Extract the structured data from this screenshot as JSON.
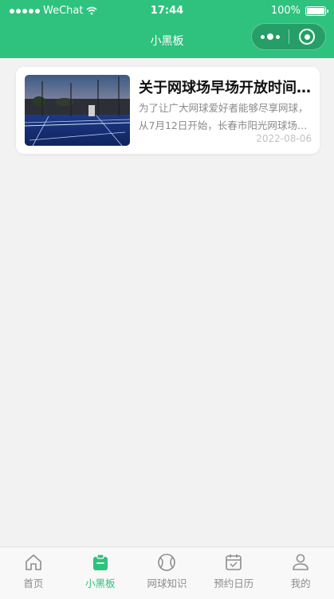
{
  "status_bar": {
    "carrier": "WeChat",
    "time": "17:44",
    "battery": "100%",
    "battery_level": 1.0
  },
  "nav": {
    "title": "小黑板"
  },
  "articles": [
    {
      "title": "关于网球场早场开放时间的通知",
      "summary": "为了让广大网球爱好者能够尽享网球，从7月12日开始，长春市阳光网球场早场开放",
      "date": "2022-08-06"
    }
  ],
  "tabbar": {
    "active_color": "#2ec27e",
    "items": [
      {
        "label": "首页",
        "icon": "home-icon",
        "active": false
      },
      {
        "label": "小黑板",
        "icon": "clipboard-icon",
        "active": true
      },
      {
        "label": "网球知识",
        "icon": "tennis-ball-icon",
        "active": false
      },
      {
        "label": "预约日历",
        "icon": "calendar-check-icon",
        "active": false
      },
      {
        "label": "我的",
        "icon": "user-icon",
        "active": false
      }
    ]
  },
  "colors": {
    "brand": "#2ec27e",
    "background": "#f2f2f2"
  }
}
